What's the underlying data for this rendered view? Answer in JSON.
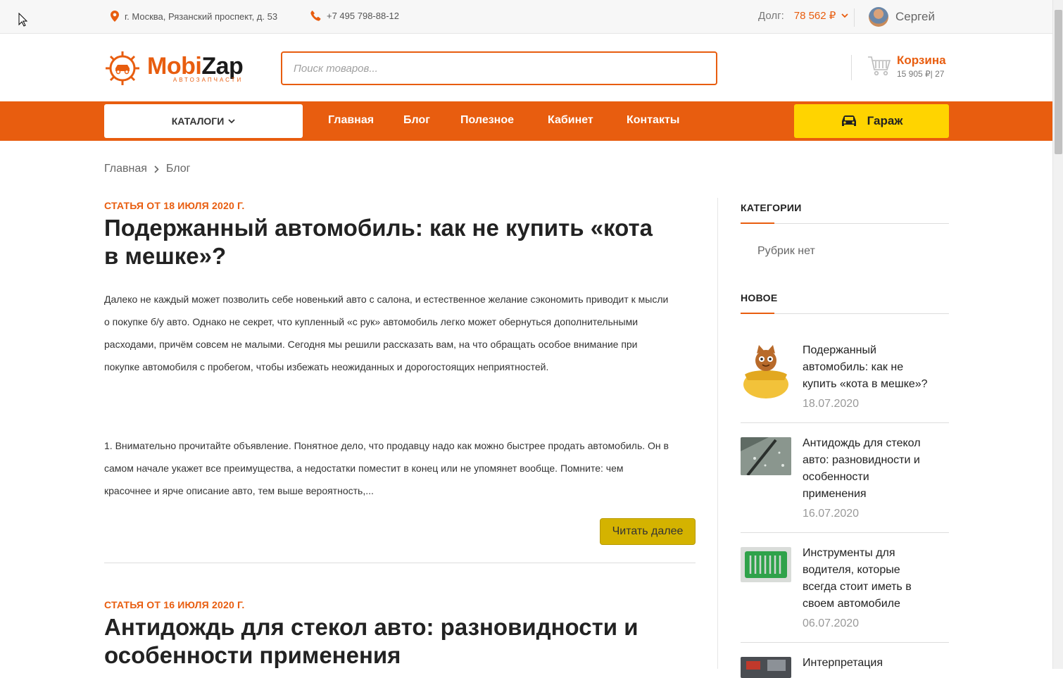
{
  "topbar": {
    "address": "г. Москва, Рязанский проспект, д. 53",
    "phone": "+7 495 798-88-12",
    "debt_label": "Долг:",
    "debt_amount": "78 562 ₽",
    "user_name": "Сергей"
  },
  "header": {
    "logo_part1": "Mobi",
    "logo_part2": "Zap",
    "logo_sub": "АВТОЗАПЧАСТИ",
    "search_placeholder": "Поиск товаров...",
    "cart_title": "Корзина",
    "cart_summary": "15 905 ₽| 27"
  },
  "nav": {
    "catalog_label": "КАТАЛОГИ",
    "links": [
      "Главная",
      "Блог",
      "Полезное",
      "Кабинет",
      "Контакты"
    ],
    "garage_label": "Гараж"
  },
  "breadcrumb": [
    "Главная",
    "Блог"
  ],
  "articles": [
    {
      "date": "СТАТЬЯ ОТ 18 ИЮЛЯ 2020 Г.",
      "title_line1": "Подержанный автомобиль: как не купить «кота",
      "title_line2": "в мешке»?",
      "para1": [
        "Далеко не каждый может позволить себе новенький авто с салона, и естественное желание сэкономить приводит к мысли",
        "о покупке б/у авто. Однако не секрет, что купленный «с рук» автомобиль легко может обернуться дополнительными",
        "расходами, причём совсем не малыми. Сегодня мы решили рассказать вам, на что обращать особое внимание при",
        "покупке автомобиля с пробегом, чтобы избежать неожиданных и дорогостоящих неприятностей."
      ],
      "para2": [
        "1. Внимательно прочитайте объявление. Понятное дело, что продавцу надо как можно быстрее продать автомобиль. Он в",
        "самом начале укажет все преимущества, а недостатки поместит в конец или не упомянет вообще. Помните: чем",
        "красочнее и ярче описание авто, тем выше вероятность,..."
      ],
      "read_more": "Читать далее"
    },
    {
      "date": "СТАТЬЯ ОТ 16 ИЮЛЯ 2020 Г.",
      "title_line1": "Антидождь для стекол авто: разновидности и",
      "title_line2": "особенности применения"
    }
  ],
  "sidebar": {
    "categories_title": "КАТЕГОРИИ",
    "no_categories": "Рубрик нет",
    "new_title": "НОВОЕ",
    "posts": [
      {
        "title_lines": [
          "Подержанный",
          "автомобиль: как не",
          "купить «кота в мешке»?"
        ],
        "date": "18.07.2020",
        "thumb": "cat-in-bag-image"
      },
      {
        "title_lines": [
          "Антидождь для стекол",
          "авто: разновидности и",
          "особенности",
          "применения"
        ],
        "date": "16.07.2020",
        "thumb": "windshield-image"
      },
      {
        "title_lines": [
          "Инструменты для",
          "водителя, которые",
          "всегда стоит иметь в",
          "своем автомобиле"
        ],
        "date": "06.07.2020",
        "thumb": "tools-image"
      },
      {
        "title_lines": [
          "Интерпретация"
        ],
        "date": "",
        "thumb": "engine-image"
      }
    ]
  },
  "colors": {
    "accent": "#e85d0f",
    "garage": "#ffd400",
    "read_more": "#d4b300"
  }
}
